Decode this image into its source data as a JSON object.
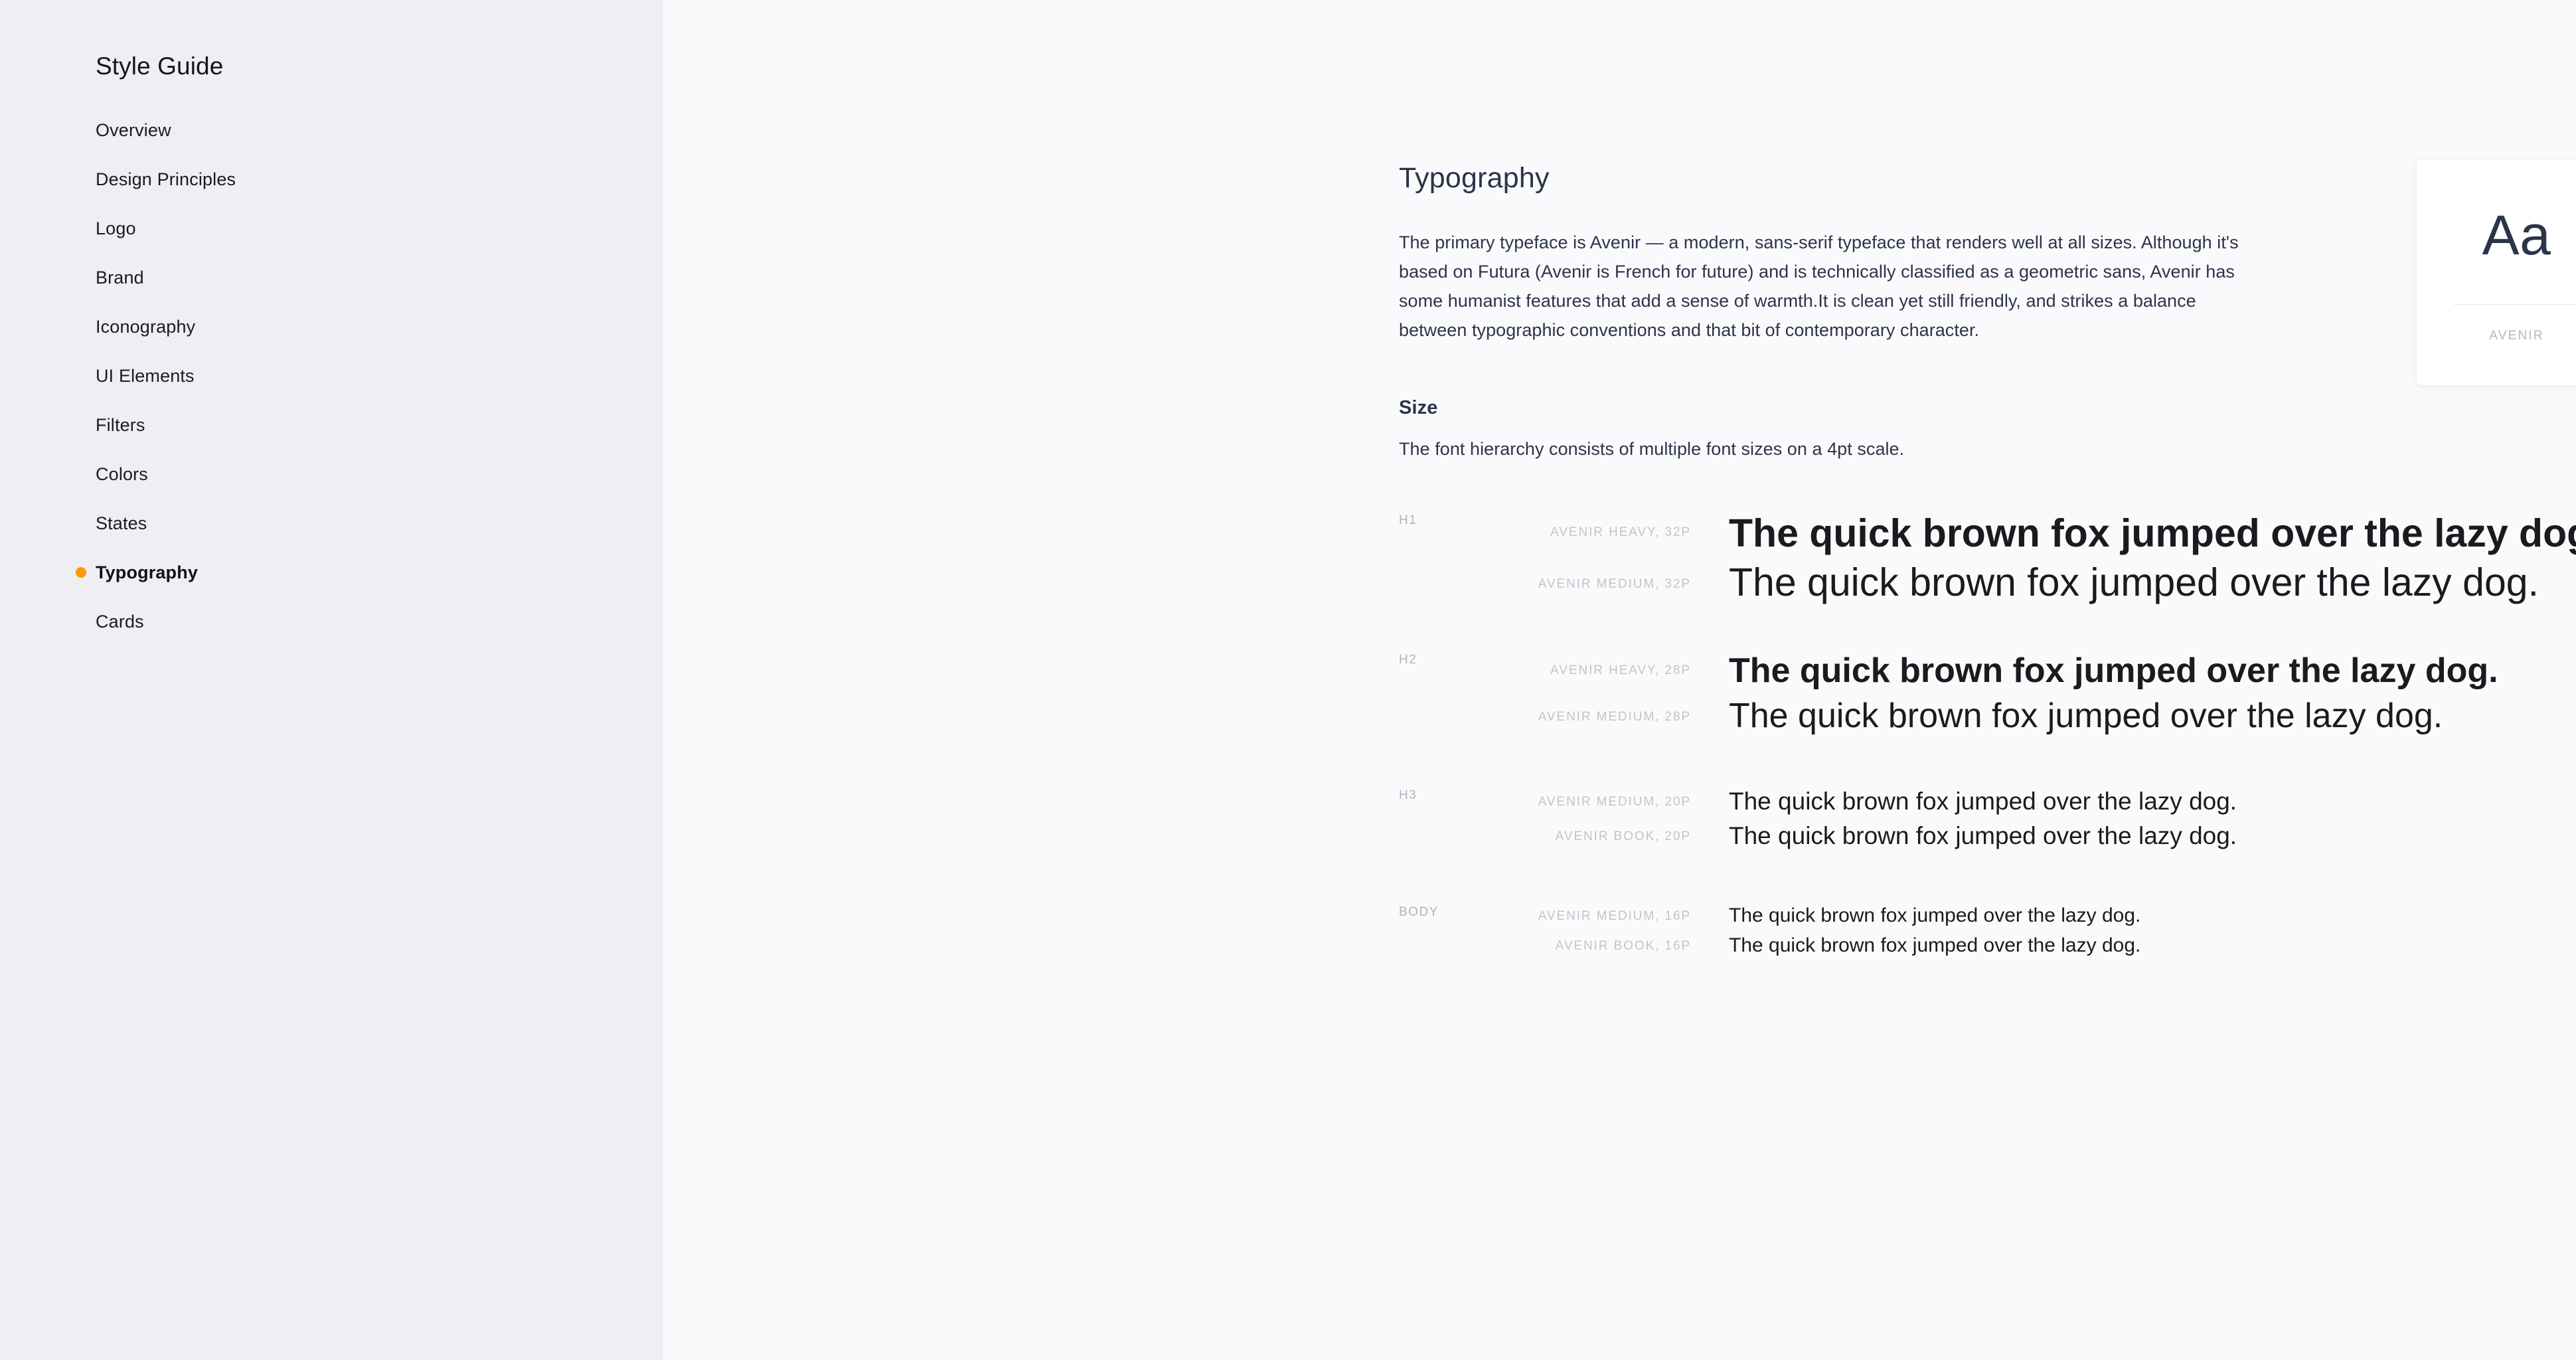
{
  "sidebar": {
    "title": "Style Guide",
    "active_bullet_color": "#FF9900",
    "items": [
      {
        "label": "Overview",
        "active": false
      },
      {
        "label": "Design Principles",
        "active": false
      },
      {
        "label": "Logo",
        "active": false
      },
      {
        "label": "Brand",
        "active": false
      },
      {
        "label": "Iconography",
        "active": false
      },
      {
        "label": "UI Elements",
        "active": false
      },
      {
        "label": "Filters",
        "active": false
      },
      {
        "label": "Colors",
        "active": false
      },
      {
        "label": "States",
        "active": false
      },
      {
        "label": "Typography",
        "active": true
      },
      {
        "label": "Cards",
        "active": false
      }
    ]
  },
  "main": {
    "page_title": "Typography",
    "intro": "The primary typeface is Avenir — a modern, sans-serif typeface that renders well at all sizes. Although it's based on Futura (Avenir is French for future) and is technically classified as a geometric sans, Avenir has some humanist features that add a sense of warmth.It is clean yet still friendly, and strikes a balance between typographic conventions and that bit of contemporary character.",
    "size_section": {
      "heading": "Size",
      "description": "The font hierarchy consists of multiple font sizes on a 4pt scale."
    },
    "specimens": [
      {
        "tag": "H1",
        "rows": [
          {
            "meta": "AVENIR HEAVY, 32P",
            "sample": "The quick brown fox jumped over the lazy dog."
          },
          {
            "meta": "AVENIR MEDIUM, 32P",
            "sample": "The quick brown fox jumped over the lazy dog."
          }
        ]
      },
      {
        "tag": "H2",
        "rows": [
          {
            "meta": "AVENIR HEAVY, 28P",
            "sample": "The quick brown fox jumped over the lazy dog."
          },
          {
            "meta": "AVENIR MEDIUM, 28P",
            "sample": "The quick brown fox jumped over the lazy dog."
          }
        ]
      },
      {
        "tag": "H3",
        "rows": [
          {
            "meta": "AVENIR MEDIUM, 20P",
            "sample": "The quick brown fox jumped over the lazy dog."
          },
          {
            "meta": "AVENIR BOOK, 20P",
            "sample": "The quick brown fox jumped over the lazy dog."
          }
        ]
      },
      {
        "tag": "BODY",
        "rows": [
          {
            "meta": "AVENIR MEDIUM, 16P",
            "sample": "The quick brown fox jumped over the lazy dog."
          },
          {
            "meta": "AVENIR BOOK, 16P",
            "sample": "The quick brown fox jumped over the lazy dog."
          }
        ]
      }
    ],
    "font_card": {
      "glyph": "Aa",
      "name": "AVENIR"
    }
  },
  "colors": {
    "sidebar_bg": "#EFEEF2",
    "content_bg": "#FAFAFC",
    "heading": "#2B3449",
    "accent": "#FF9900",
    "meta_label": "#C3C4C9",
    "card_bg": "#FFFFFF"
  }
}
